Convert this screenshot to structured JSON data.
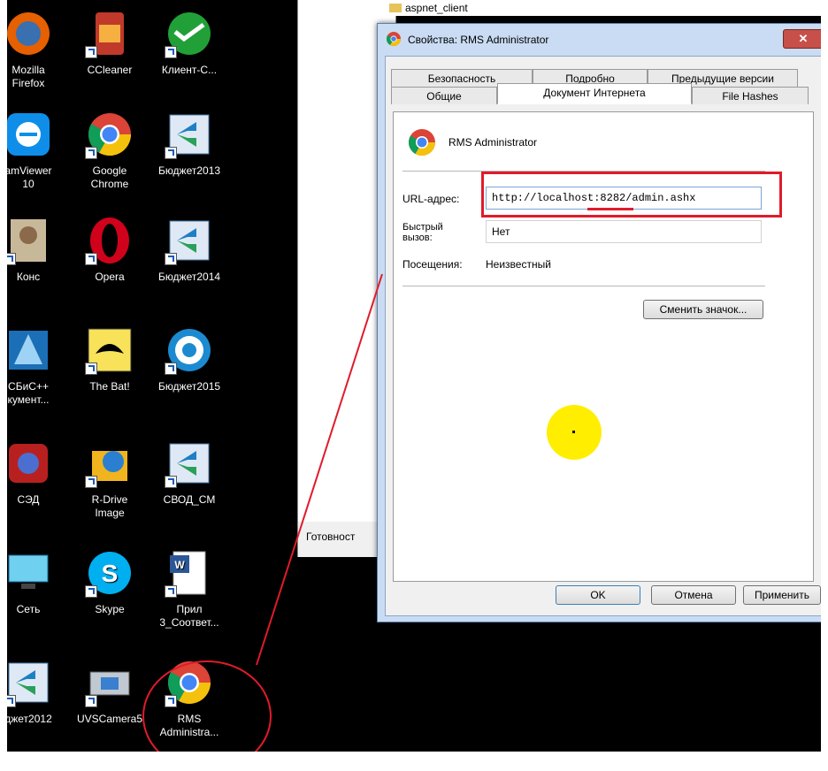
{
  "desktop": {
    "icons": [
      {
        "label": "Mozilla\nFirefox",
        "icon": "firefox-icon"
      },
      {
        "label": "CCleaner",
        "icon": "ccleaner-icon"
      },
      {
        "label": "Клиент-С...",
        "icon": "sberbank-client-icon"
      },
      {
        "label": "amViewer\n10",
        "icon": "teamviewer-icon"
      },
      {
        "label": "Google\nChrome",
        "icon": "chrome-icon"
      },
      {
        "label": "Бюджет2013",
        "icon": "budget-icon"
      },
      {
        "label": "Конс",
        "icon": "consultant-icon"
      },
      {
        "label": "Opera",
        "icon": "opera-icon"
      },
      {
        "label": "Бюджет2014",
        "icon": "budget-icon"
      },
      {
        "label": "СБиС++\nкумент...",
        "icon": "sbis-icon"
      },
      {
        "label": "The Bat!",
        "icon": "the-bat-icon"
      },
      {
        "label": "Бюджет2015",
        "icon": "budget2015-icon"
      },
      {
        "label": "СЭД",
        "icon": "sed-icon"
      },
      {
        "label": "R-Drive\nImage",
        "icon": "rdrive-icon"
      },
      {
        "label": "СВОД_СМ",
        "icon": "budget-icon"
      },
      {
        "label": "Сеть",
        "icon": "network-icon"
      },
      {
        "label": "Skype",
        "icon": "skype-icon"
      },
      {
        "label": "Прил\n3_Соответ...",
        "icon": "word-document-icon"
      },
      {
        "label": "джет2012",
        "icon": "budget-icon"
      },
      {
        "label": "UVSCamera5",
        "icon": "camera-icon"
      },
      {
        "label": "RMS\nAdministra...",
        "icon": "chrome-icon"
      }
    ]
  },
  "background_window": {
    "folder_item": "aspnet_client",
    "status_text": "Готовност"
  },
  "dialog": {
    "title": "Свойства: RMS Administrator",
    "close_label": "✕",
    "tabs_row1": [
      "Безопасность",
      "Подробно",
      "Предыдущие версии"
    ],
    "tabs_row2": [
      "Общие",
      "Документ Интернета",
      "File Hashes"
    ],
    "active_tab": "Документ Интернета",
    "item_name": "RMS Administrator",
    "url_label": "URL-адрес:",
    "url_value": "http://localhost:8282/admin.ashx",
    "hotkey_label": "Быстрый\nвызов:",
    "hotkey_value": "Нет",
    "visits_label": "Посещения:",
    "visits_value": "Неизвестный",
    "change_icon_button": "Сменить значок...",
    "ok_button": "OK",
    "cancel_button": "Отмена",
    "apply_button": "Применить"
  },
  "annotations": {
    "highlight_color": "#e01b2a",
    "cursor_color": "#ffee00"
  }
}
